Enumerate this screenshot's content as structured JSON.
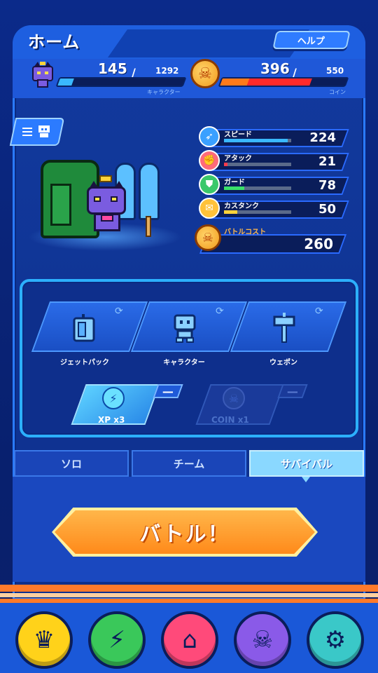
{
  "header": {
    "title": "ホーム",
    "help_label": "ヘルプ"
  },
  "resources": {
    "character": {
      "current": "145",
      "slash": "/",
      "max": "1292",
      "label": "キャラクター",
      "fill": 0.11,
      "color": "#3ab8ff"
    },
    "coin": {
      "current": "396",
      "slash": "/",
      "max": "550",
      "label": "コイン",
      "fill": 0.72,
      "color": "#ff2a2a"
    }
  },
  "stats": [
    {
      "name": "スピード",
      "value": "224",
      "fill": 0.95,
      "color": "#3ab8ff",
      "icon": "wing-icon",
      "icon_bg": "#3aa0ff",
      "glyph": "➶"
    },
    {
      "name": "アタック",
      "value": "21",
      "fill": 0.05,
      "color": "#ff3a4a",
      "icon": "fist-icon",
      "icon_bg": "#ff6a7a",
      "glyph": "✊"
    },
    {
      "name": "ガード",
      "value": "78",
      "fill": 0.3,
      "color": "#3ae06a",
      "icon": "shield-icon",
      "icon_bg": "#3ac86a",
      "glyph": "⛊"
    },
    {
      "name": "カスタンク",
      "value": "50",
      "fill": 0.2,
      "color": "#ffd23a",
      "icon": "tank-icon",
      "icon_bg": "#ffc23a",
      "glyph": "✉"
    }
  ],
  "battle_cost": {
    "label": "バトルコスト",
    "value": "260"
  },
  "equipment": [
    {
      "label": "ジェットパック",
      "icon": "jetpack-icon"
    },
    {
      "label": "キャラクター",
      "icon": "character-icon"
    },
    {
      "label": "ウェポン",
      "icon": "hammer-icon"
    }
  ],
  "boosts": [
    {
      "label": "XP x3",
      "active": true,
      "dash": "—"
    },
    {
      "label": "COIN x1",
      "active": false,
      "dash": "—"
    }
  ],
  "modes": [
    {
      "label": "ソロ",
      "active": false
    },
    {
      "label": "チーム",
      "active": false
    },
    {
      "label": "サバイバル",
      "active": true
    }
  ],
  "battle_button": "バトル！",
  "nav": [
    {
      "icon": "crown-icon",
      "color": "#ffd21a",
      "glyph": "♛"
    },
    {
      "icon": "versus-icon",
      "color": "#3ac85a",
      "glyph": "⚡"
    },
    {
      "icon": "home-icon",
      "color": "#ff4a7a",
      "glyph": "⌂"
    },
    {
      "icon": "shop-bag-icon",
      "color": "#8a5ae8",
      "glyph": "☠"
    },
    {
      "icon": "settings-tools-icon",
      "color": "#3ac8c8",
      "glyph": "⚙"
    }
  ]
}
